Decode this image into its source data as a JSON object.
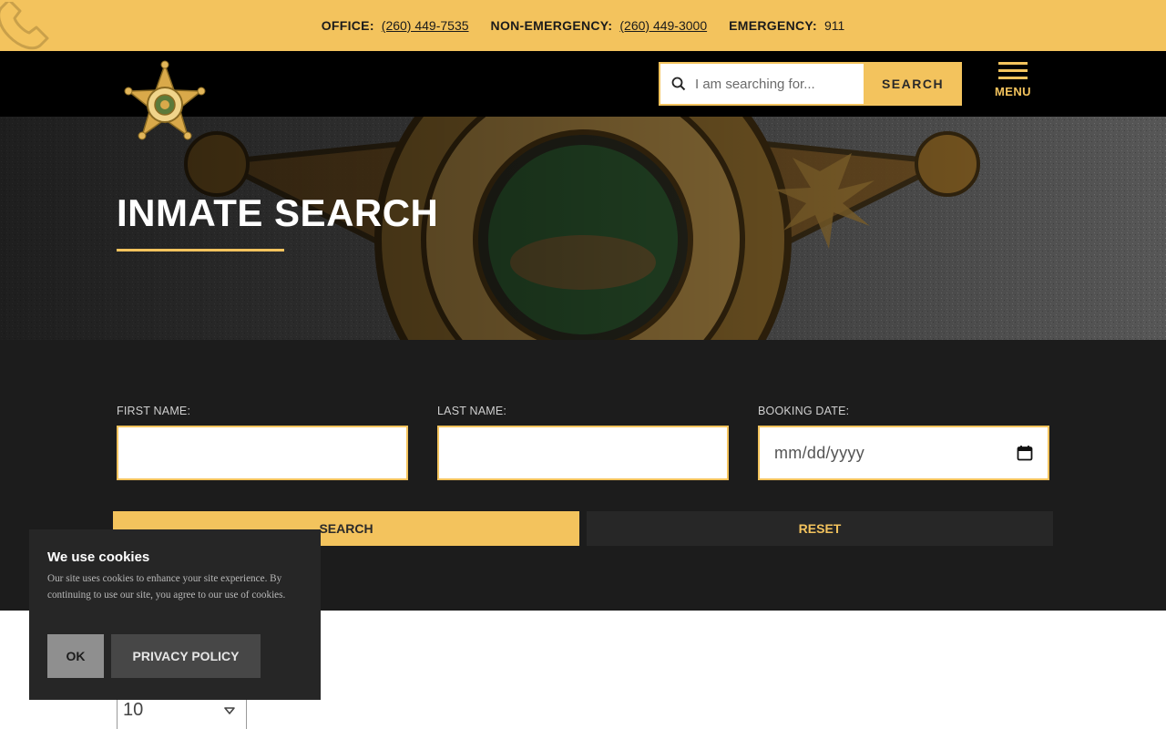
{
  "topbar": {
    "office_label": "OFFICE:",
    "office_number": "(260) 449-7535",
    "nonemergency_label": "NON-EMERGENCY:",
    "nonemergency_number": "(260) 449-3000",
    "emergency_label": "EMERGENCY:",
    "emergency_number": "911",
    "decor_icon": "phone-icon"
  },
  "header": {
    "logo_icon": "sheriff-star-badge-icon",
    "search_placeholder": "I am searching for...",
    "search_button": "SEARCH",
    "search_icon": "magnifier-icon",
    "menu_label": "MENU",
    "menu_icon": "hamburger-icon"
  },
  "hero": {
    "title": "INMATE SEARCH"
  },
  "form": {
    "first_name_label": "FIRST NAME:",
    "first_name_value": "",
    "last_name_label": "LAST NAME:",
    "last_name_value": "",
    "booking_date_label": "BOOKING DATE:",
    "booking_date_placeholder": "mm/dd/yyyy",
    "calendar_icon": "calendar-icon",
    "search_button": "SEARCH",
    "reset_button": "RESET"
  },
  "results": {
    "page_size": "10"
  },
  "cookie_banner": {
    "title": "We use cookies",
    "body": "Our site uses cookies to enhance your site experience. By continuing to use our site, you agree to our use of cookies.",
    "ok_button": "OK",
    "privacy_button": "PRIVACY POLICY"
  },
  "colors": {
    "accent": "#f3c35d",
    "dark": "#1c1c1c",
    "nav": "#000000"
  }
}
